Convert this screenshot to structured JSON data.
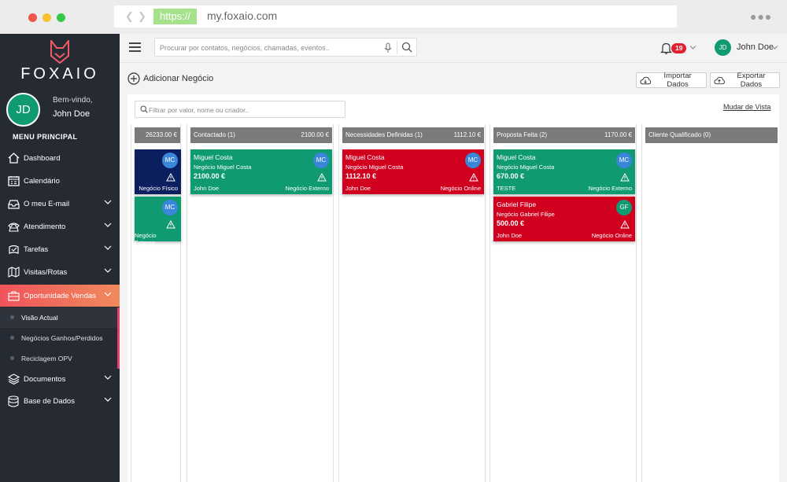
{
  "browser": {
    "scheme": "https://",
    "url": "my.foxaio.com"
  },
  "sidebar": {
    "logo_text": "FOXAIO",
    "avatar_initials": "JD",
    "welcome": "Bem-vindo,",
    "user_name": "John Doe",
    "menu_title": "MENU PRINCIPAL",
    "items": [
      {
        "label": "Dashboard",
        "icon": "home-icon"
      },
      {
        "label": "Calendário",
        "icon": "calendar-icon"
      },
      {
        "label": "O meu E-mail",
        "icon": "inbox-icon"
      },
      {
        "label": "Atendimento",
        "icon": "phone-icon"
      },
      {
        "label": "Tarefas",
        "icon": "tasks-icon"
      },
      {
        "label": "Visitas/Rotas",
        "icon": "map-icon"
      },
      {
        "label": "Oportunidade Vendas",
        "icon": "briefcase-icon"
      },
      {
        "label": "Documentos",
        "icon": "layers-icon"
      },
      {
        "label": "Base de Dados",
        "icon": "database-icon"
      }
    ],
    "submenu": [
      {
        "label": "Visão Actual"
      },
      {
        "label": "Negócios Ganhos/Perdidos"
      },
      {
        "label": "Reciclagem OPV"
      }
    ],
    "colors": {
      "background": "#262b33",
      "active_from": "#f0545b",
      "active_to": "#f08a5d"
    }
  },
  "topbar": {
    "search_placeholder": "Procurar por contatos, negócios, chamadas, eventos..",
    "notifications": "19",
    "user_initials": "JD",
    "user_name": "John Doe"
  },
  "toolbar": {
    "add_deal": "Adicionar Negócio",
    "import": "Importar Dados",
    "export": "Exportar Dados",
    "filter_placeholder": "Filtrar por valor, nome ou criador..",
    "change_view": "Mudar de Vista"
  },
  "pipeline": {
    "columns": [
      {
        "name": "",
        "total": "26233.00 €",
        "cards": [
          {
            "name": "",
            "deal": "",
            "value": "",
            "owner": "",
            "type": "Negócio Físico",
            "initials": "MC",
            "color": "#0b1e5e",
            "avatar_color": "#3a86d8"
          },
          {
            "name": "",
            "deal": "",
            "value": "",
            "owner": "",
            "type": "Negócio Externo",
            "initials": "MC",
            "color": "#0f9a72",
            "avatar_color": "#3a86d8"
          }
        ]
      },
      {
        "name": "Contactado (1)",
        "total": "2100.00 €",
        "cards": [
          {
            "name": "Miguel Costa",
            "deal": "Negócio Miguel Costa",
            "value": "2100.00 €",
            "owner": "John Doe",
            "type": "Negócio Externo",
            "initials": "MC",
            "color": "#0f9a72",
            "avatar_color": "#3a86d8"
          }
        ]
      },
      {
        "name": "Necessidades Definidas (1)",
        "total": "1112.10 €",
        "cards": [
          {
            "name": "Miguel Costa",
            "deal": "Negócio Miguel Costa",
            "value": "1112.10 €",
            "owner": "John Doe",
            "type": "Negócio Online",
            "initials": "MC",
            "color": "#d1001f",
            "avatar_color": "#3a86d8"
          }
        ]
      },
      {
        "name": "Proposta Feita (2)",
        "total": "1170.00 €",
        "cards": [
          {
            "name": "Miguel Costa",
            "deal": "Negócio Miguel Costa",
            "value": "670.00 €",
            "owner": "TESTE",
            "type": "Negócio Externo",
            "initials": "MC",
            "color": "#0f9a72",
            "avatar_color": "#3a86d8"
          },
          {
            "name": "Gabriel Filipe",
            "deal": "Negócio Gabriel Filipe",
            "value": "500.00 €",
            "owner": "John Doe",
            "type": "Negócio Online",
            "initials": "GF",
            "color": "#d1001f",
            "avatar_color": "#0f9a72"
          }
        ]
      },
      {
        "name": "Cliente Qualificado (0)",
        "total": "",
        "cards": []
      }
    ]
  }
}
